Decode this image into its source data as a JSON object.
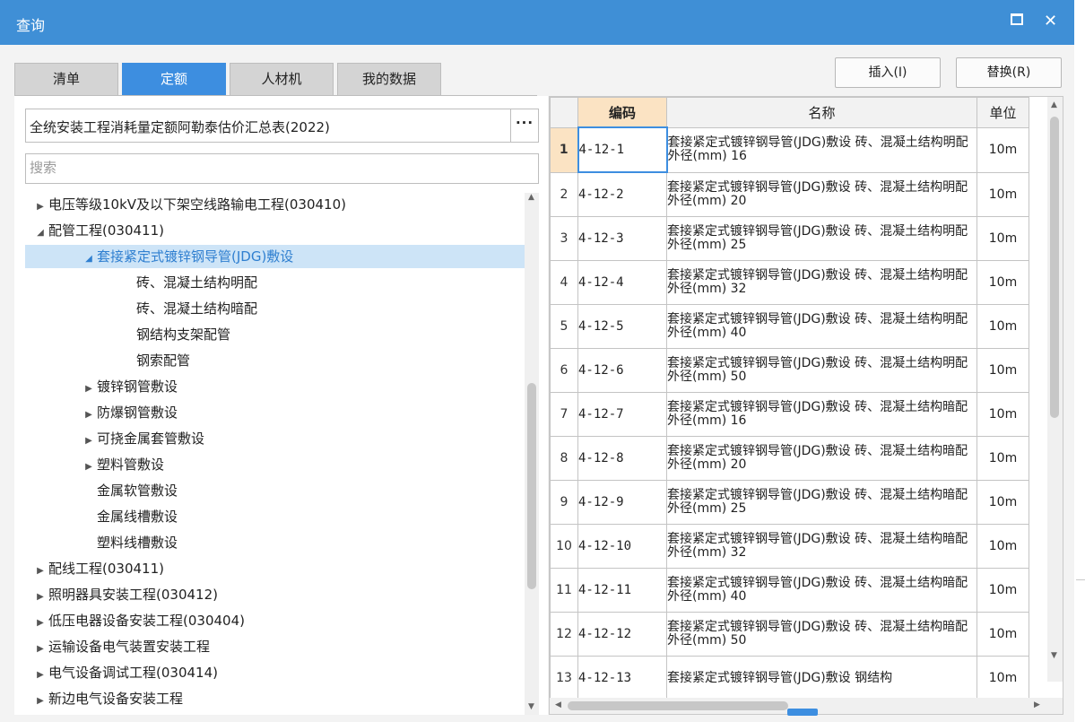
{
  "window": {
    "title": "查询",
    "maximize_icon": "maximize-icon",
    "close_icon": "close-icon",
    "close_glyph": "✕"
  },
  "tabs": [
    {
      "label": "清单",
      "active": false
    },
    {
      "label": "定额",
      "active": true
    },
    {
      "label": "人材机",
      "active": false
    },
    {
      "label": "我的数据",
      "active": false
    }
  ],
  "actions": {
    "insert_label": "插入(I)",
    "replace_label": "替换(R)"
  },
  "library": {
    "value": "全统安装工程消耗量定额阿勒泰估价汇总表(2022)",
    "more_label": "···"
  },
  "search": {
    "placeholder": "搜索",
    "value": ""
  },
  "tree": [
    {
      "label": "电压等级10kV及以下架空线路输电工程(030410)",
      "toggle": "▶",
      "level": 0
    },
    {
      "label": "配管工程(030411)",
      "toggle": "◢",
      "level": 0
    },
    {
      "label": "套接紧定式镀锌钢导管(JDG)敷设",
      "toggle": "◢",
      "level": 1,
      "selected": true
    },
    {
      "label": "砖、混凝土结构明配",
      "toggle": "",
      "level": 2
    },
    {
      "label": "砖、混凝土结构暗配",
      "toggle": "",
      "level": 2
    },
    {
      "label": "钢结构支架配管",
      "toggle": "",
      "level": 2
    },
    {
      "label": "钢索配管",
      "toggle": "",
      "level": 2
    },
    {
      "label": "镀锌钢管敷设",
      "toggle": "▶",
      "level": 1
    },
    {
      "label": "防爆钢管敷设",
      "toggle": "▶",
      "level": 1
    },
    {
      "label": "可挠金属套管敷设",
      "toggle": "▶",
      "level": 1
    },
    {
      "label": "塑料管敷设",
      "toggle": "▶",
      "level": 1
    },
    {
      "label": "金属软管敷设",
      "toggle": "",
      "level": 1
    },
    {
      "label": "金属线槽敷设",
      "toggle": "",
      "level": 1
    },
    {
      "label": "塑料线槽敷设",
      "toggle": "",
      "level": 1
    },
    {
      "label": "配线工程(030411)",
      "toggle": "▶",
      "level": 0
    },
    {
      "label": "照明器具安装工程(030412)",
      "toggle": "▶",
      "level": 0
    },
    {
      "label": "低压电器设备安装工程(030404)",
      "toggle": "▶",
      "level": 0
    },
    {
      "label": "运输设备电气装置安装工程",
      "toggle": "▶",
      "level": 0
    },
    {
      "label": "电气设备调试工程(030414)",
      "toggle": "▶",
      "level": 0
    },
    {
      "label": "新边电气设备安装工程",
      "toggle": "▶",
      "level": 0
    }
  ],
  "grid": {
    "headers": {
      "code": "编码",
      "name": "名称",
      "unit": "单位"
    },
    "rows": [
      {
        "n": "1",
        "code": "4-12-1",
        "name": "套接紧定式镀锌钢导管(JDG)敷设 砖、混凝土结构明配 外径(mm) 16",
        "unit": "10m"
      },
      {
        "n": "2",
        "code": "4-12-2",
        "name": "套接紧定式镀锌钢导管(JDG)敷设 砖、混凝土结构明配 外径(mm) 20",
        "unit": "10m"
      },
      {
        "n": "3",
        "code": "4-12-3",
        "name": "套接紧定式镀锌钢导管(JDG)敷设 砖、混凝土结构明配 外径(mm) 25",
        "unit": "10m"
      },
      {
        "n": "4",
        "code": "4-12-4",
        "name": "套接紧定式镀锌钢导管(JDG)敷设 砖、混凝土结构明配 外径(mm) 32",
        "unit": "10m"
      },
      {
        "n": "5",
        "code": "4-12-5",
        "name": "套接紧定式镀锌钢导管(JDG)敷设 砖、混凝土结构明配 外径(mm) 40",
        "unit": "10m"
      },
      {
        "n": "6",
        "code": "4-12-6",
        "name": "套接紧定式镀锌钢导管(JDG)敷设 砖、混凝土结构明配 外径(mm) 50",
        "unit": "10m"
      },
      {
        "n": "7",
        "code": "4-12-7",
        "name": "套接紧定式镀锌钢导管(JDG)敷设 砖、混凝土结构暗配 外径(mm) 16",
        "unit": "10m"
      },
      {
        "n": "8",
        "code": "4-12-8",
        "name": "套接紧定式镀锌钢导管(JDG)敷设 砖、混凝土结构暗配 外径(mm) 20",
        "unit": "10m"
      },
      {
        "n": "9",
        "code": "4-12-9",
        "name": "套接紧定式镀锌钢导管(JDG)敷设 砖、混凝土结构暗配 外径(mm) 25",
        "unit": "10m"
      },
      {
        "n": "10",
        "code": "4-12-10",
        "name": "套接紧定式镀锌钢导管(JDG)敷设 砖、混凝土结构暗配 外径(mm) 32",
        "unit": "10m"
      },
      {
        "n": "11",
        "code": "4-12-11",
        "name": "套接紧定式镀锌钢导管(JDG)敷设 砖、混凝土结构暗配 外径(mm) 40",
        "unit": "10m"
      },
      {
        "n": "12",
        "code": "4-12-12",
        "name": "套接紧定式镀锌钢导管(JDG)敷设 砖、混凝土结构暗配 外径(mm) 50",
        "unit": "10m"
      },
      {
        "n": "13",
        "code": "4-12-13",
        "name": "套接紧定式镀锌钢导管(JDG)敷设 钢结构",
        "unit": "10m"
      }
    ]
  },
  "colors": {
    "titlebar": "#3f8fd6",
    "tab_active": "#3d8ee0",
    "selection": "#cde4f7",
    "code_header": "#fbe3c3"
  }
}
